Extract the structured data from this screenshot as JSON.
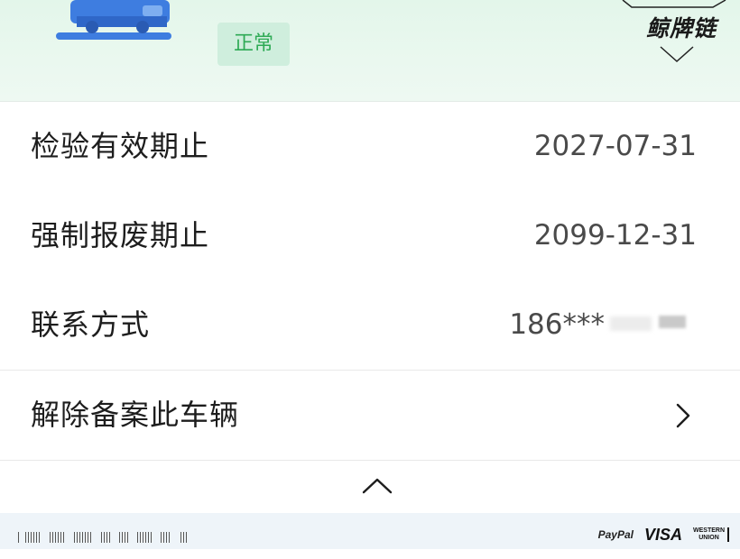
{
  "header": {
    "status": "正常",
    "logo_text": "鲸牌链",
    "colors": {
      "band": "#e3f6ea",
      "status_bg": "#cfeedd",
      "status_text": "#2eaa55",
      "car_blue": "#3e7de0"
    }
  },
  "rows": [
    {
      "label": "检验有效期止",
      "value": "2027-07-31"
    },
    {
      "label": "强制报废期止",
      "value": "2099-12-31"
    },
    {
      "label": "联系方式",
      "value": "186***"
    },
    {
      "label": "解除备案此车辆",
      "action_icon": "chevron-right-icon"
    }
  ],
  "collapse_icon": "caret-up-icon",
  "footer": {
    "paypal": "PayPal",
    "visa": "VISA",
    "western_union": [
      "WESTERN",
      "UNION"
    ]
  }
}
